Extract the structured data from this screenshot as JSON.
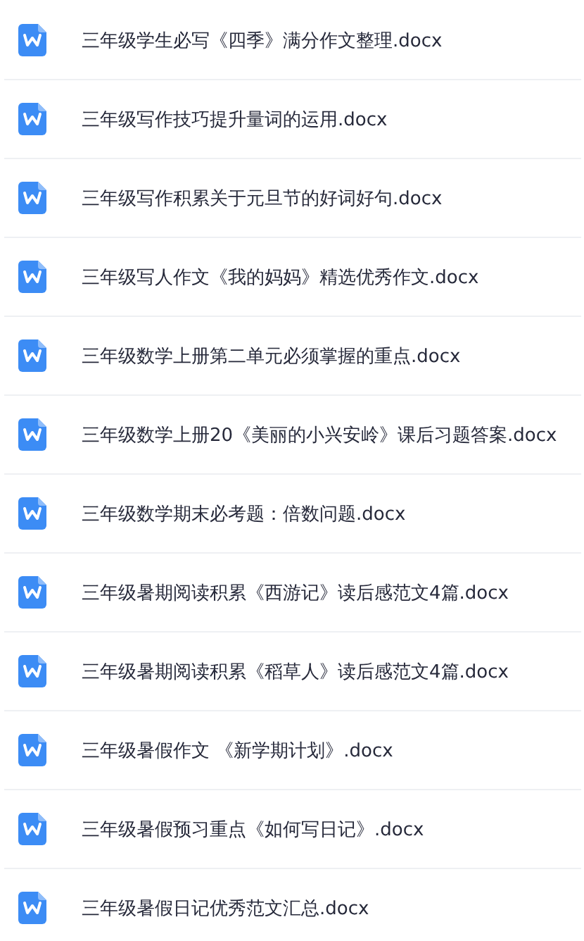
{
  "files": [
    {
      "name": "三年级学生必写《四季》满分作文整理.docx"
    },
    {
      "name": "三年级写作技巧提升量词的运用.docx"
    },
    {
      "name": "三年级写作积累关于元旦节的好词好句.docx"
    },
    {
      "name": "三年级写人作文《我的妈妈》精选优秀作文.docx"
    },
    {
      "name": "三年级数学上册第二单元必须掌握的重点.docx"
    },
    {
      "name": "三年级数学上册20《美丽的小兴安岭》课后习题答案.docx"
    },
    {
      "name": "三年级数学期末必考题：倍数问题.docx"
    },
    {
      "name": "三年级暑期阅读积累《西游记》读后感范文4篇.docx"
    },
    {
      "name": "三年级暑期阅读积累《稻草人》读后感范文4篇.docx"
    },
    {
      "name": "三年级暑假作文 《新学期计划》.docx"
    },
    {
      "name": "三年级暑假预习重点《如何写日记》.docx"
    },
    {
      "name": "三年级暑假日记优秀范文汇总.docx"
    }
  ]
}
